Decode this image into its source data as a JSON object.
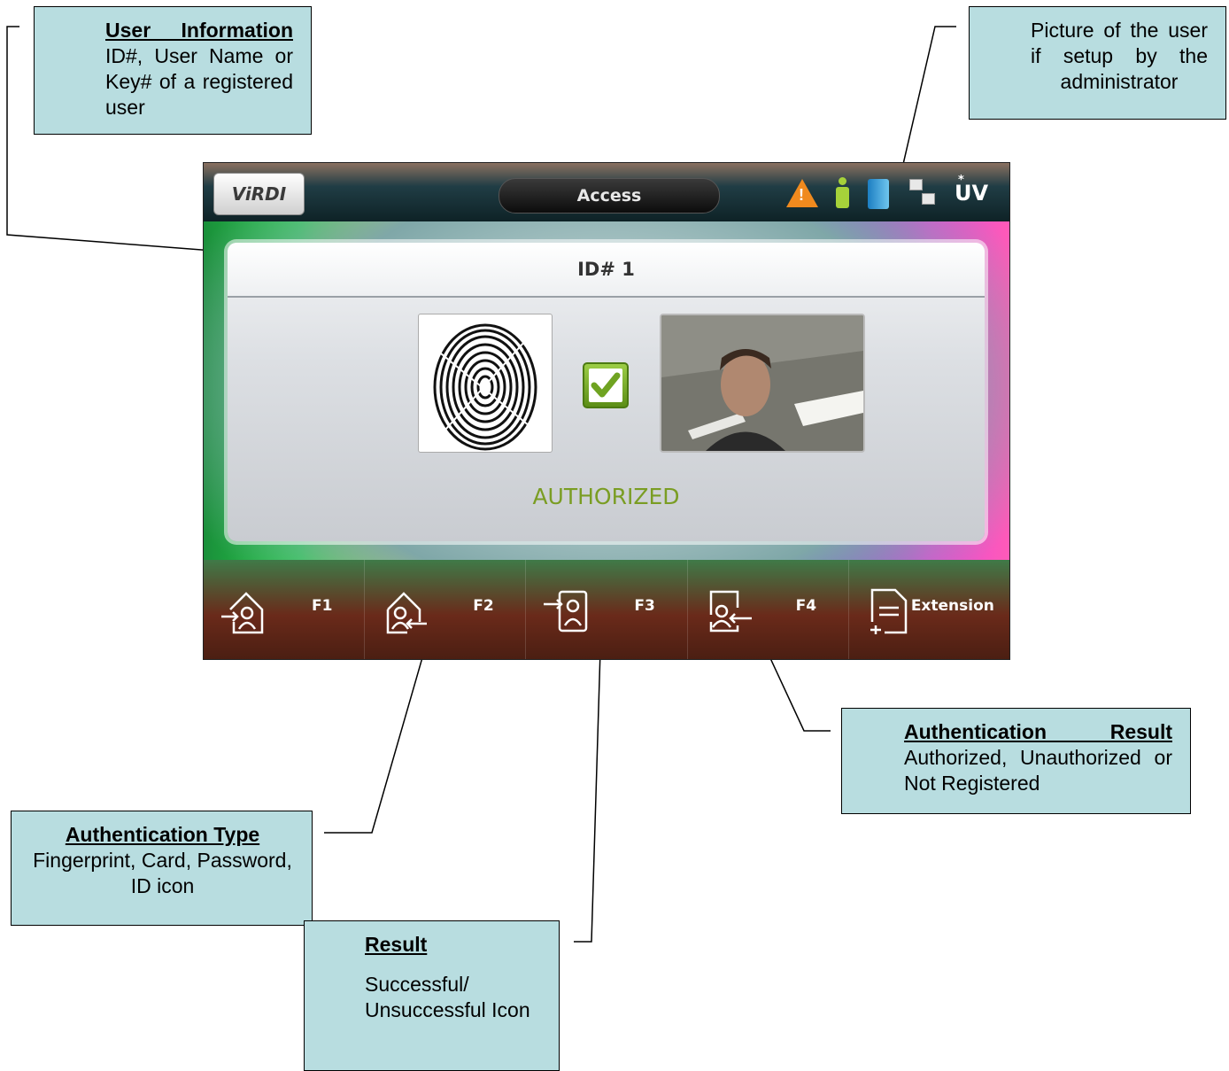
{
  "device": {
    "logo": "ViRDI",
    "title": "Access",
    "status_icons": [
      "warning-icon",
      "person-icon",
      "door-icon",
      "network-icon",
      "uv-icon"
    ],
    "uv_label": "UV",
    "warning_glyph": "!",
    "id_text": "ID# 1",
    "auth_result": "AUTHORIZED",
    "auth_color": "#7a9d23",
    "function_keys": [
      {
        "label": "F1",
        "icon": "enter-home-icon"
      },
      {
        "label": "F2",
        "icon": "leave-home-icon"
      },
      {
        "label": "F3",
        "icon": "enter-door-icon"
      },
      {
        "label": "F4",
        "icon": "leave-door-icon"
      },
      {
        "label": "Extension",
        "icon": "document-add-icon"
      }
    ]
  },
  "callouts": {
    "user_info": {
      "title": "User Information",
      "body": "ID#, User Name or Key# of a registered user"
    },
    "picture": {
      "body": "Picture of the user if setup by the administrator"
    },
    "auth_result": {
      "title": "Authentication Result",
      "body": "Authorized, Unauthorized or Not Registered"
    },
    "auth_type": {
      "title": "Authentication Type",
      "body": "Fingerprint, Card, Password, ID icon"
    },
    "result": {
      "title": "Result",
      "body": "Successful/ Unsuccessful Icon"
    }
  },
  "colors": {
    "callout_bg": "#b8dde0",
    "check_green": "#6fa321"
  }
}
